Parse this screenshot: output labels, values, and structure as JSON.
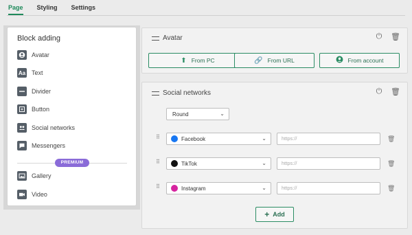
{
  "tabs": [
    {
      "label": "Page",
      "active": true
    },
    {
      "label": "Styling",
      "active": false
    },
    {
      "label": "Settings",
      "active": false
    }
  ],
  "sidebar": {
    "title": "Block adding",
    "items": [
      {
        "label": "Avatar",
        "icon": "avatar-icon"
      },
      {
        "label": "Text",
        "icon": "text-icon"
      },
      {
        "label": "Divider",
        "icon": "divider-icon"
      },
      {
        "label": "Button",
        "icon": "button-icon"
      },
      {
        "label": "Social networks",
        "icon": "people-icon"
      },
      {
        "label": "Messengers",
        "icon": "chat-icon"
      }
    ],
    "premium_badge": "PREMIUM",
    "premium_items": [
      {
        "label": "Gallery",
        "icon": "gallery-icon"
      },
      {
        "label": "Video",
        "icon": "video-icon"
      }
    ]
  },
  "avatar_card": {
    "title": "Avatar",
    "buttons": [
      {
        "label": "From PC",
        "icon": "upload-icon"
      },
      {
        "label": "From URL",
        "icon": "link-icon"
      },
      {
        "label": "From account",
        "icon": "account-icon"
      }
    ]
  },
  "social_card": {
    "title": "Social networks",
    "style_select": "Round",
    "networks": [
      {
        "name": "Facebook",
        "url_placeholder": "https://",
        "color": "#1877f2"
      },
      {
        "name": "TikTok",
        "url_placeholder": "https://",
        "color": "#111111"
      },
      {
        "name": "Instagram",
        "url_placeholder": "https://",
        "color": "#d6249f"
      }
    ],
    "add_label": "Add"
  },
  "colors": {
    "accent": "#2a8c63",
    "premium": "#8a6bd8"
  }
}
